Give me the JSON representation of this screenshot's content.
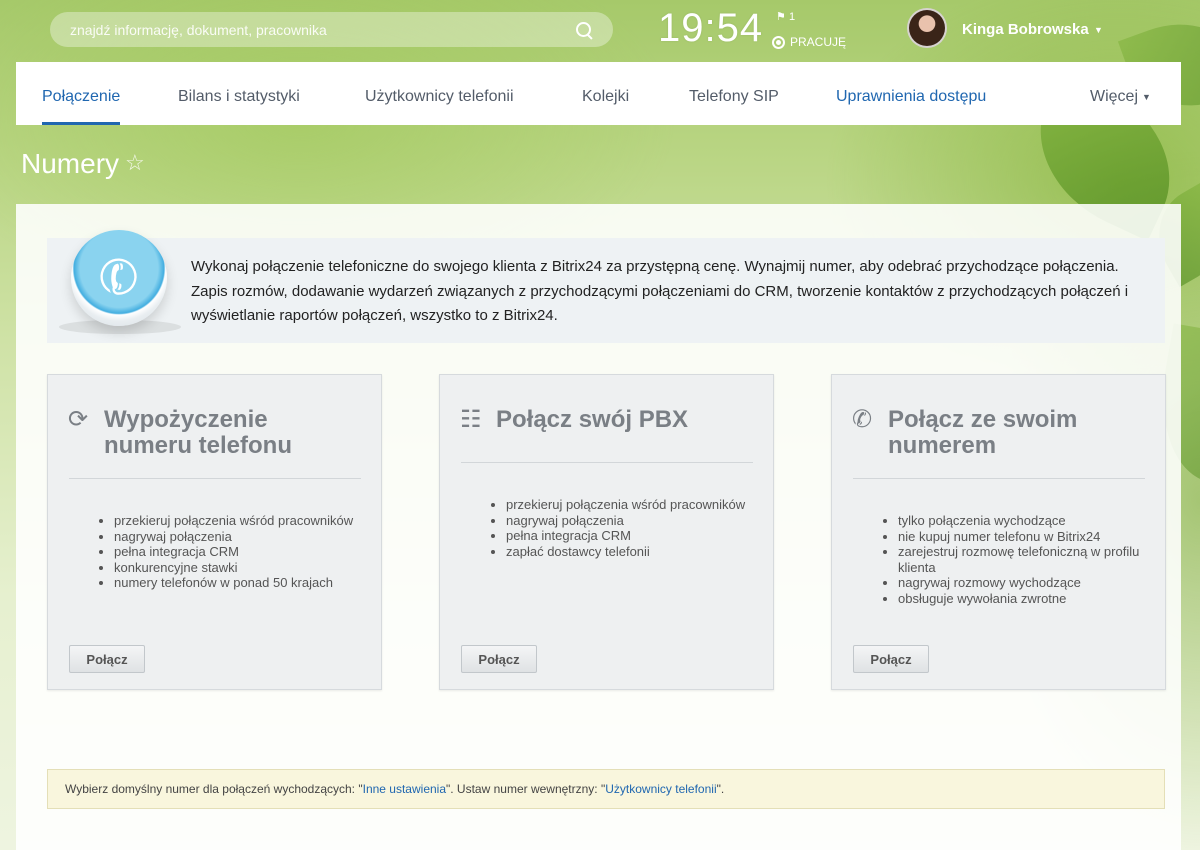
{
  "search": {
    "placeholder": "znajdź informację, dokument, pracownika"
  },
  "header": {
    "clock": "19:54",
    "flag_count": "1",
    "status": "PRACUJĘ",
    "username": "Kinga Bobrowska"
  },
  "nav": {
    "items": [
      {
        "label": "Połączenie"
      },
      {
        "label": "Bilans i statystyki"
      },
      {
        "label": "Użytkownicy telefonii"
      },
      {
        "label": "Kolejki"
      },
      {
        "label": "Telefony SIP"
      },
      {
        "label": "Uprawnienia dostępu"
      }
    ],
    "more": "Więcej"
  },
  "page": {
    "title": "Numery"
  },
  "intro": {
    "text": "Wykonaj połączenie telefoniczne do swojego klienta z Bitrix24 za przystępną cenę. Wynajmij numer, aby odebrać przychodzące połączenia. Zapis rozmów, dodawanie wydarzeń związanych z przychodzącymi połączeniami do CRM, tworzenie kontaktów z przychodzących połączeń i wyświetlanie raportów połączeń, wszystko to z Bitrix24."
  },
  "cards": [
    {
      "title_line1": "Wypożyczenie",
      "title_line2": "numeru telefonu",
      "icon": "rent-number-icon",
      "features": [
        "przekieruj połączenia wśród pracowników",
        "nagrywaj połączenia",
        "pełna integracja CRM",
        "konkurencyjne stawki",
        "numery telefonów w ponad 50 krajach"
      ],
      "button": "Połącz"
    },
    {
      "title_line1": "Połącz swój PBX",
      "title_line2": "",
      "icon": "pbx-icon",
      "features": [
        "przekieruj połączenia wśród pracowników",
        "nagrywaj połączenia",
        "pełna integracja CRM",
        "zapłać dostawcy telefonii"
      ],
      "button": "Połącz"
    },
    {
      "title_line1": "Połącz ze swoim",
      "title_line2": "numerem",
      "icon": "own-number-icon",
      "features": [
        "tylko połączenia wychodzące",
        "nie kupuj numer telefonu w Bitrix24",
        "zarejestruj rozmowę telefoniczną w profilu klienta",
        "nagrywaj rozmowy wychodzące",
        "obsługuje wywołania zwrotne"
      ],
      "button": "Połącz"
    }
  ],
  "notice": {
    "prefix": "Wybierz domyślny numer dla połączeń wychodzących: \"",
    "link1": "Inne ustawienia",
    "middle": "\". Ustaw numer wewnętrzny: \"",
    "link2": "Użytkownicy telefonii",
    "suffix": "\"."
  },
  "colors": {
    "accent": "#2067b0",
    "notice_bg": "#f9f6dd"
  }
}
